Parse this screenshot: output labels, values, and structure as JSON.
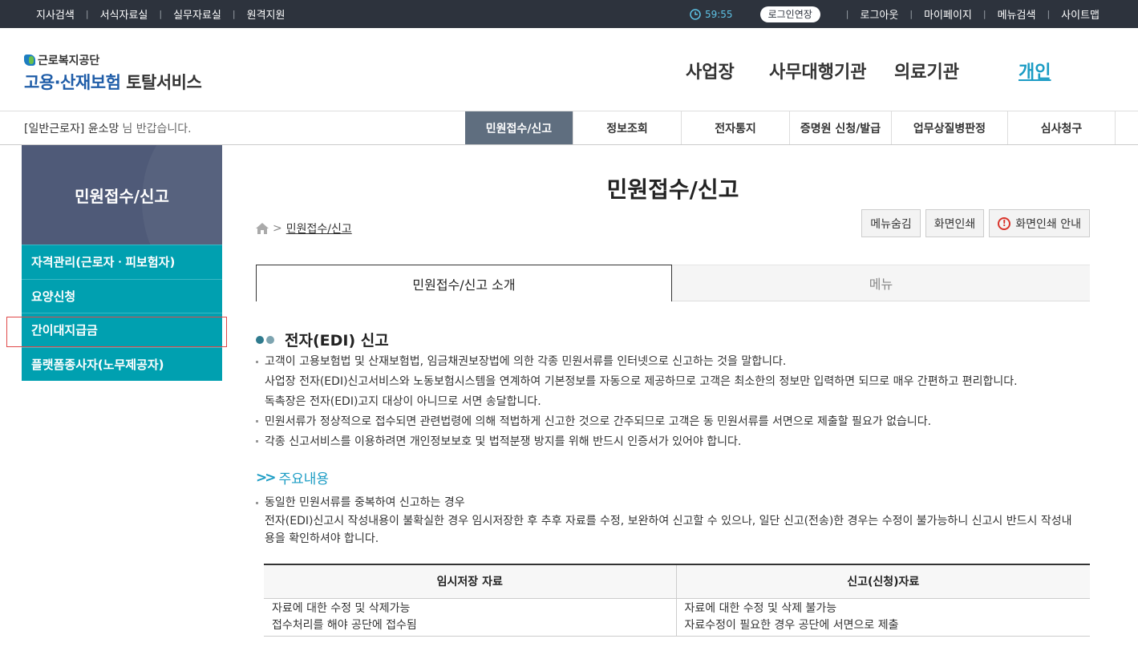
{
  "topbar": {
    "links": [
      "지사검색",
      "서식자료실",
      "실무자료실",
      "원격지원"
    ],
    "time": "59:55",
    "extend_label": "로그인연장",
    "right_links": [
      "로그아웃",
      "마이페이지",
      "메뉴검색",
      "사이트맵"
    ]
  },
  "header": {
    "logo_sub": "근로복지공단",
    "logo_main_a": "고용·산재보험",
    "logo_main_b": "토탈서비스",
    "gnb": [
      "사업장",
      "사무대행기관",
      "의료기관",
      "개인"
    ]
  },
  "subbar": {
    "user_type": "[일반근로자]",
    "user_name": "윤소망",
    "greeting": "님 반갑습니다.",
    "tabs": [
      "민원접수/신고",
      "정보조회",
      "전자통지",
      "증명원 신청/발급",
      "업무상질병판정",
      "심사청구"
    ]
  },
  "lnb": {
    "title": "민원접수/신고",
    "items": [
      "자격관리(근로자ㆍ피보험자)",
      "요양신청",
      "간이대지급금",
      "플랫폼종사자(노무제공자)"
    ]
  },
  "content": {
    "page_title": "민원접수/신고",
    "breadcrumb_current": "민원접수/신고",
    "buttons": [
      "메뉴숨김",
      "화면인쇄",
      "화면인쇄 안내"
    ],
    "tabs": [
      "민원접수/신고 소개",
      "메뉴"
    ],
    "section_title": "전자(EDI) 신고",
    "paragraphs": [
      "고객이 고용보험법 및 산재보험법, 임금채권보장법에 의한 각종 민원서류를 인터넷으로 신고하는 것을 말합니다.",
      "사업장 전자(EDI)신고서비스와 노동보험시스템을 연계하여 기본정보를 자동으로 제공하므로 고객은 최소한의 정보만 입력하면 되므로 매우 간편하고 편리합니다.",
      "독촉장은 전자(EDI)고지 대상이 아니므로 서면 송달합니다.",
      "민원서류가 정상적으로 접수되면 관련법령에 의해 적법하게 신고한 것으로 간주되므로 고객은 동 민원서류를 서면으로 제출할 필요가 없습니다.",
      "각종 신고서비스를 이용하려면 개인정보보호 및 법적분쟁 방지를 위해 반드시 인증서가 있어야 합니다."
    ],
    "sub_title": "주요내용",
    "sub_paragraphs": [
      "동일한 민원서류를 중복하여 신고하는 경우",
      "전자(EDI)신고시 작성내용이 불확실한 경우 임시저장한 후 추후 자료를 수정, 보완하여 신고할 수 있으나, 일단 신고(전송)한 경우는 수정이 불가능하니 신고시 반드시 작성내",
      "용을 확인하셔야 합니다."
    ],
    "table": {
      "headers": [
        "임시저장 자료",
        "신고(신청)자료"
      ],
      "col1": [
        "자료에 대한 수정 및 삭제가능",
        "접수처리를 해야 공단에 접수됨"
      ],
      "col2": [
        "자료에 대한 수정 및 삭제 불가능",
        "자료수정이 필요한 경우 공단에 서면으로 제출"
      ]
    }
  },
  "colors": {
    "topbar": "#2d333d",
    "accent": "#00a0b0",
    "active_tab": "#5f6e7f",
    "lnb_head": "#4f5a78"
  }
}
